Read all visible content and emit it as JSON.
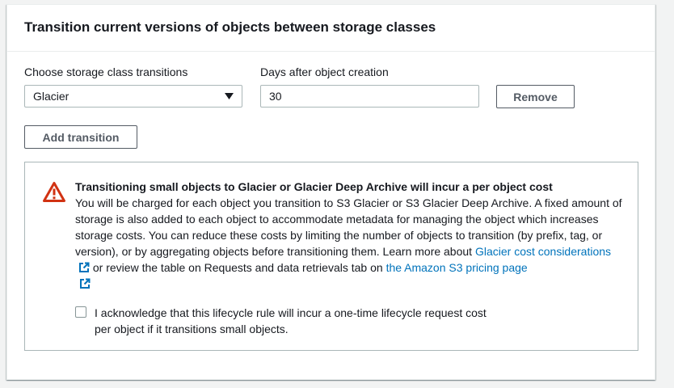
{
  "panel": {
    "title": "Transition current versions of objects between storage classes"
  },
  "transition": {
    "storage_class_label": "Choose storage class transitions",
    "storage_class_value": "Glacier",
    "days_label": "Days after object creation",
    "days_value": "30",
    "remove_label": "Remove",
    "add_label": "Add transition"
  },
  "alert": {
    "title": "Transitioning small objects to Glacier or Glacier Deep Archive will incur a per object cost",
    "body_text": "You will be charged for each object you transition to S3 Glacier or S3 Glacier Deep Archive. A fixed amount of storage is also added to each object to accommodate metadata for managing the object which increases storage costs. You can reduce these costs by limiting the number of objects to transition (by prefix, tag, or version), or by aggregating objects before transitioning them. Learn more about",
    "link1": "Glacier cost considerations",
    "middle_text": "or review the table on Requests and data retrievals tab on",
    "link2": "the Amazon S3 pricing page",
    "icon": "warning-icon",
    "color": "#d13212"
  },
  "acknowledge": {
    "label": "I acknowledge that this lifecycle rule will incur a one-time lifecycle request cost per object if it transitions small objects.",
    "checked": false
  }
}
